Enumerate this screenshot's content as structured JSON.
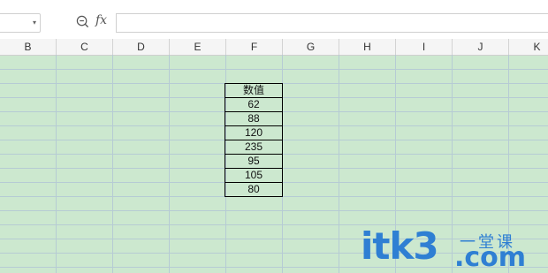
{
  "toolbar": {
    "name_box_value": "",
    "zoom_icon": "zoom-icon",
    "fx_label": "fx",
    "formula_value": ""
  },
  "columns": [
    "B",
    "C",
    "D",
    "E",
    "F",
    "G",
    "H",
    "I",
    "J",
    "K"
  ],
  "table": {
    "header": "数值",
    "values": [
      "62",
      "88",
      "120",
      "235",
      "95",
      "105",
      "80"
    ]
  },
  "watermark": {
    "main": "itk3",
    "cn": "一堂课",
    "com": ".com"
  },
  "colors": {
    "sheet_background": "#cce8cf",
    "gridline": "#b6cbd4",
    "watermark": "#2f7fd3"
  }
}
